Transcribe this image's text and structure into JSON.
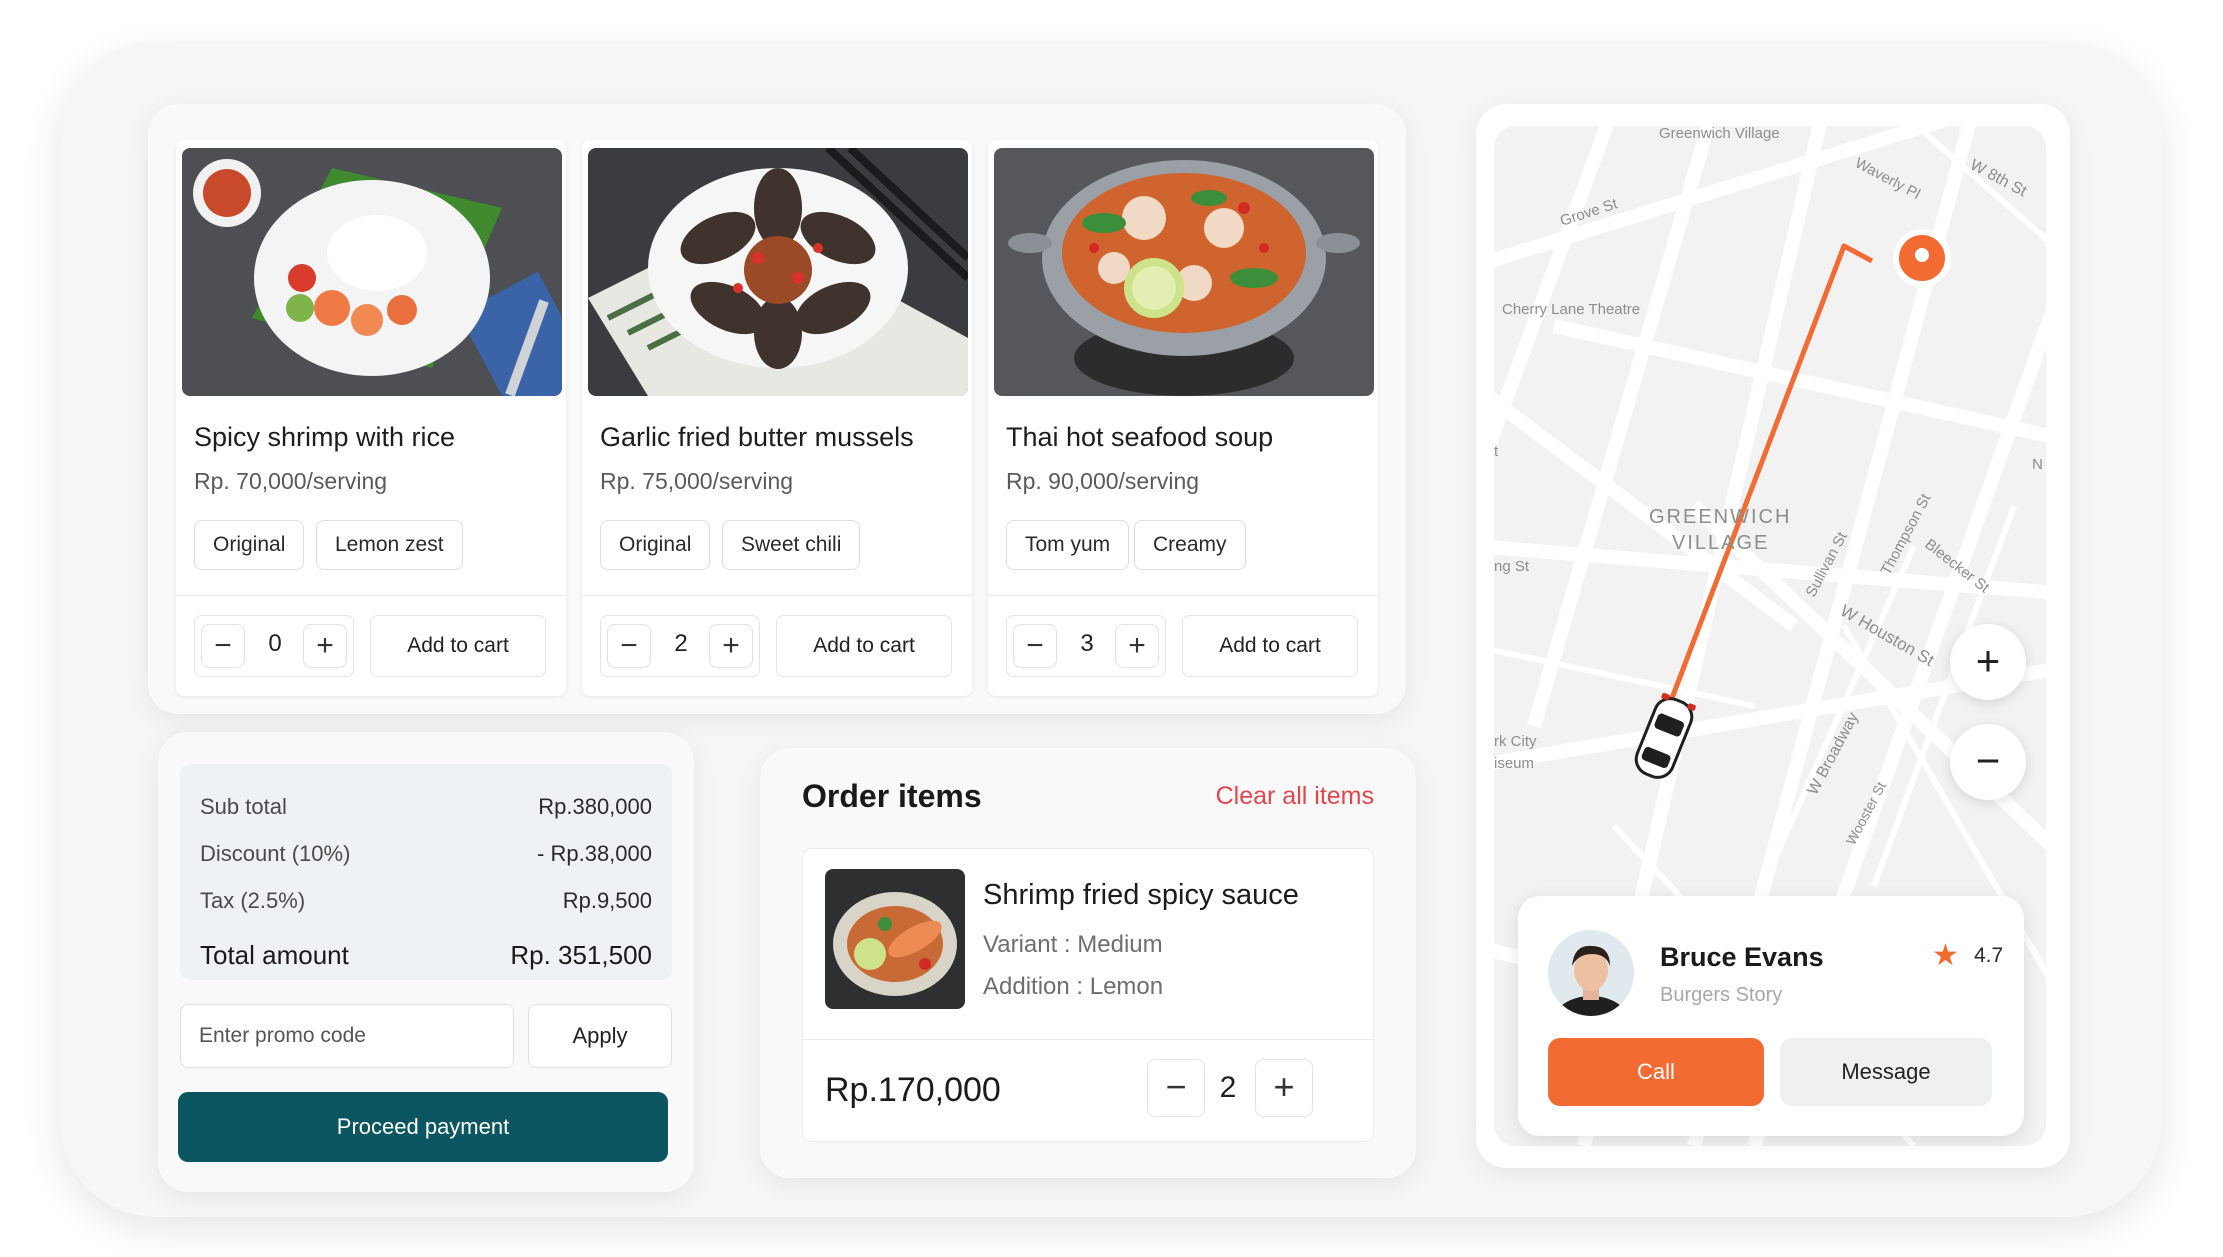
{
  "menu": {
    "items": [
      {
        "name": "Spicy shrimp with rice",
        "price": "Rp. 70,000/serving",
        "options": [
          "Original",
          "Lemon zest"
        ],
        "quantity": "0",
        "add_label": "Add to cart"
      },
      {
        "name": "Garlic fried butter mussels",
        "price": "Rp. 75,000/serving",
        "options": [
          "Original",
          "Sweet chili"
        ],
        "quantity": "2",
        "add_label": "Add to cart"
      },
      {
        "name": "Thai hot seafood soup",
        "price": "Rp. 90,000/serving",
        "options": [
          "Tom yum",
          "Creamy"
        ],
        "quantity": "3",
        "add_label": "Add to cart"
      }
    ],
    "minus_symbol": "−",
    "plus_symbol": "+"
  },
  "summary": {
    "subtotal_label": "Sub total",
    "subtotal_value": "Rp.380,000",
    "discount_label": "Discount (10%)",
    "discount_value": "- Rp.38,000",
    "tax_label": "Tax (2.5%)",
    "tax_value": "Rp.9,500",
    "total_label": "Total amount",
    "total_value": "Rp. 351,500",
    "promo_placeholder": "Enter promo code",
    "apply_label": "Apply",
    "proceed_label": "Proceed payment"
  },
  "order": {
    "title": "Order items",
    "clear_label": "Clear all items",
    "item": {
      "name": "Shrimp fried spicy sauce",
      "variant": "Variant : Medium",
      "addition": "Addition : Lemon",
      "price": "Rp.170,000",
      "quantity": "2"
    }
  },
  "map": {
    "labels": {
      "greenwich_village_top": "Greenwich Village",
      "waverly": "Waverly Pl",
      "w8th": "W 8th St",
      "grove": "Grove St",
      "cherry_lane": "Cherry Lane Theatre",
      "area_line1": "GREENWICH",
      "area_line2": "VILLAGE",
      "sullivan": "Sullivan St",
      "thompson": "Thompson St",
      "bleecker": "Bleecker St",
      "w_houston": "W Houston St",
      "broadway": "W Broadway",
      "wooster": "Wooster St",
      "ng_st": "ng St",
      "city_museum_1": "rk City",
      "city_museum_2": "iseum",
      "n_marker": "N",
      "t_marker": "t"
    },
    "zoom_in": "+",
    "zoom_out": "−",
    "route_color": "#f26b32",
    "accent_color": "#f26b32"
  },
  "driver": {
    "name": "Bruce Evans",
    "company": "Burgers Story",
    "rating": "4.7",
    "call_label": "Call",
    "message_label": "Message"
  },
  "colors": {
    "primary_teal": "#0b5660",
    "danger_red": "#e2454b",
    "accent_orange": "#f26b32"
  }
}
